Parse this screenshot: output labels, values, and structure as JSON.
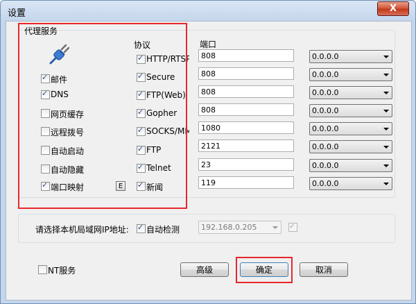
{
  "window": {
    "title": "设置",
    "close_label": "X"
  },
  "proxy_group": {
    "title": "代理服务",
    "protocol_header": "协议",
    "port_header": "端口"
  },
  "services": [
    {
      "label": "邮件",
      "checked": true
    },
    {
      "label": "DNS",
      "checked": true
    },
    {
      "label": "网页缓存",
      "checked": false
    },
    {
      "label": "远程拨号",
      "checked": false
    },
    {
      "label": "自动启动",
      "checked": false
    },
    {
      "label": "自动隐藏",
      "checked": false
    },
    {
      "label": "端口映射",
      "checked": true
    }
  ],
  "mapping_button": "E",
  "protocols": [
    {
      "label": "HTTP/RTSP",
      "checked": true,
      "port": "808",
      "address": "0.0.0.0"
    },
    {
      "label": "Secure",
      "checked": true,
      "port": "808",
      "address": "0.0.0.0"
    },
    {
      "label": "FTP(Web)",
      "checked": true,
      "port": "808",
      "address": "0.0.0.0"
    },
    {
      "label": "Gopher",
      "checked": true,
      "port": "808",
      "address": "0.0.0.0"
    },
    {
      "label": "SOCKS/MMS",
      "checked": true,
      "port": "1080",
      "address": "0.0.0.0"
    },
    {
      "label": "FTP",
      "checked": true,
      "port": "2121",
      "address": "0.0.0.0"
    },
    {
      "label": "Telnet",
      "checked": true,
      "port": "23",
      "address": "0.0.0.0"
    },
    {
      "label": "新闻",
      "checked": true,
      "port": "119",
      "address": "0.0.0.0"
    }
  ],
  "ip_section": {
    "label": "请选择本机局域网IP地址:",
    "auto_detect_label": "自动检测",
    "auto_detect_checked": true,
    "ip_value": "192.168.0.205"
  },
  "footer": {
    "nt_service_label": "NT服务",
    "nt_service_checked": false,
    "advanced": "高级",
    "ok": "确定",
    "cancel": "取消"
  },
  "colors": {
    "highlight": "#e8272c",
    "close_button": "#c13a1c"
  }
}
